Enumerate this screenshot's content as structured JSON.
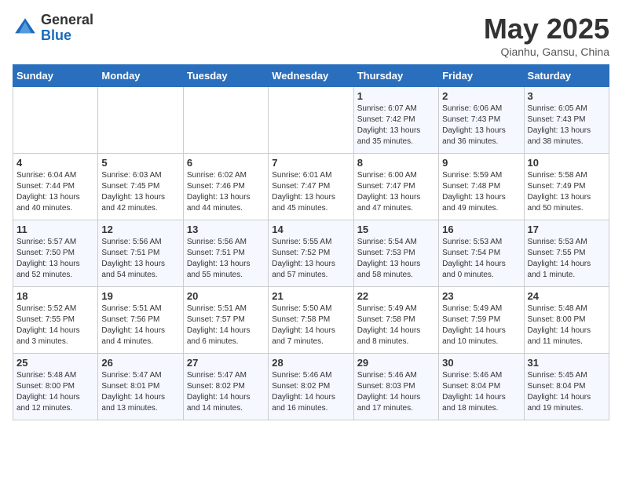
{
  "logo": {
    "general": "General",
    "blue": "Blue"
  },
  "title": "May 2025",
  "location": "Qianhu, Gansu, China",
  "weekdays": [
    "Sunday",
    "Monday",
    "Tuesday",
    "Wednesday",
    "Thursday",
    "Friday",
    "Saturday"
  ],
  "weeks": [
    [
      {
        "day": "",
        "info": ""
      },
      {
        "day": "",
        "info": ""
      },
      {
        "day": "",
        "info": ""
      },
      {
        "day": "",
        "info": ""
      },
      {
        "day": "1",
        "info": "Sunrise: 6:07 AM\nSunset: 7:42 PM\nDaylight: 13 hours\nand 35 minutes."
      },
      {
        "day": "2",
        "info": "Sunrise: 6:06 AM\nSunset: 7:43 PM\nDaylight: 13 hours\nand 36 minutes."
      },
      {
        "day": "3",
        "info": "Sunrise: 6:05 AM\nSunset: 7:43 PM\nDaylight: 13 hours\nand 38 minutes."
      }
    ],
    [
      {
        "day": "4",
        "info": "Sunrise: 6:04 AM\nSunset: 7:44 PM\nDaylight: 13 hours\nand 40 minutes."
      },
      {
        "day": "5",
        "info": "Sunrise: 6:03 AM\nSunset: 7:45 PM\nDaylight: 13 hours\nand 42 minutes."
      },
      {
        "day": "6",
        "info": "Sunrise: 6:02 AM\nSunset: 7:46 PM\nDaylight: 13 hours\nand 44 minutes."
      },
      {
        "day": "7",
        "info": "Sunrise: 6:01 AM\nSunset: 7:47 PM\nDaylight: 13 hours\nand 45 minutes."
      },
      {
        "day": "8",
        "info": "Sunrise: 6:00 AM\nSunset: 7:47 PM\nDaylight: 13 hours\nand 47 minutes."
      },
      {
        "day": "9",
        "info": "Sunrise: 5:59 AM\nSunset: 7:48 PM\nDaylight: 13 hours\nand 49 minutes."
      },
      {
        "day": "10",
        "info": "Sunrise: 5:58 AM\nSunset: 7:49 PM\nDaylight: 13 hours\nand 50 minutes."
      }
    ],
    [
      {
        "day": "11",
        "info": "Sunrise: 5:57 AM\nSunset: 7:50 PM\nDaylight: 13 hours\nand 52 minutes."
      },
      {
        "day": "12",
        "info": "Sunrise: 5:56 AM\nSunset: 7:51 PM\nDaylight: 13 hours\nand 54 minutes."
      },
      {
        "day": "13",
        "info": "Sunrise: 5:56 AM\nSunset: 7:51 PM\nDaylight: 13 hours\nand 55 minutes."
      },
      {
        "day": "14",
        "info": "Sunrise: 5:55 AM\nSunset: 7:52 PM\nDaylight: 13 hours\nand 57 minutes."
      },
      {
        "day": "15",
        "info": "Sunrise: 5:54 AM\nSunset: 7:53 PM\nDaylight: 13 hours\nand 58 minutes."
      },
      {
        "day": "16",
        "info": "Sunrise: 5:53 AM\nSunset: 7:54 PM\nDaylight: 14 hours\nand 0 minutes."
      },
      {
        "day": "17",
        "info": "Sunrise: 5:53 AM\nSunset: 7:55 PM\nDaylight: 14 hours\nand 1 minute."
      }
    ],
    [
      {
        "day": "18",
        "info": "Sunrise: 5:52 AM\nSunset: 7:55 PM\nDaylight: 14 hours\nand 3 minutes."
      },
      {
        "day": "19",
        "info": "Sunrise: 5:51 AM\nSunset: 7:56 PM\nDaylight: 14 hours\nand 4 minutes."
      },
      {
        "day": "20",
        "info": "Sunrise: 5:51 AM\nSunset: 7:57 PM\nDaylight: 14 hours\nand 6 minutes."
      },
      {
        "day": "21",
        "info": "Sunrise: 5:50 AM\nSunset: 7:58 PM\nDaylight: 14 hours\nand 7 minutes."
      },
      {
        "day": "22",
        "info": "Sunrise: 5:49 AM\nSunset: 7:58 PM\nDaylight: 14 hours\nand 8 minutes."
      },
      {
        "day": "23",
        "info": "Sunrise: 5:49 AM\nSunset: 7:59 PM\nDaylight: 14 hours\nand 10 minutes."
      },
      {
        "day": "24",
        "info": "Sunrise: 5:48 AM\nSunset: 8:00 PM\nDaylight: 14 hours\nand 11 minutes."
      }
    ],
    [
      {
        "day": "25",
        "info": "Sunrise: 5:48 AM\nSunset: 8:00 PM\nDaylight: 14 hours\nand 12 minutes."
      },
      {
        "day": "26",
        "info": "Sunrise: 5:47 AM\nSunset: 8:01 PM\nDaylight: 14 hours\nand 13 minutes."
      },
      {
        "day": "27",
        "info": "Sunrise: 5:47 AM\nSunset: 8:02 PM\nDaylight: 14 hours\nand 14 minutes."
      },
      {
        "day": "28",
        "info": "Sunrise: 5:46 AM\nSunset: 8:02 PM\nDaylight: 14 hours\nand 16 minutes."
      },
      {
        "day": "29",
        "info": "Sunrise: 5:46 AM\nSunset: 8:03 PM\nDaylight: 14 hours\nand 17 minutes."
      },
      {
        "day": "30",
        "info": "Sunrise: 5:46 AM\nSunset: 8:04 PM\nDaylight: 14 hours\nand 18 minutes."
      },
      {
        "day": "31",
        "info": "Sunrise: 5:45 AM\nSunset: 8:04 PM\nDaylight: 14 hours\nand 19 minutes."
      }
    ]
  ]
}
